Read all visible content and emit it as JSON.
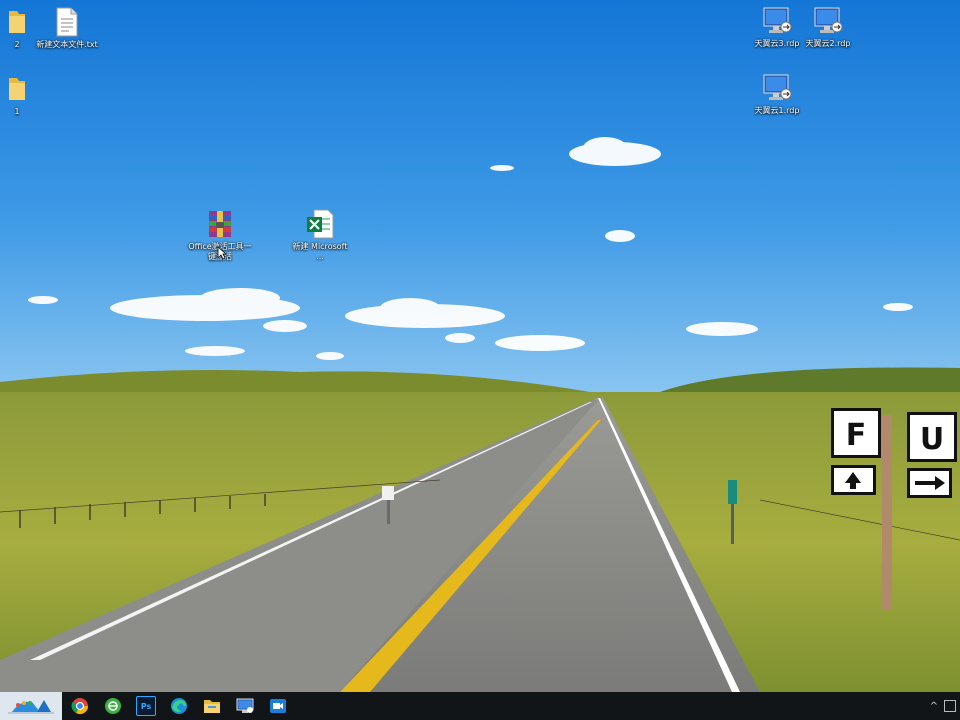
{
  "desktop": {
    "icons": [
      {
        "label": "2",
        "icon": "folder-icon"
      },
      {
        "label": "新建文本文件.txt",
        "icon": "text-file-icon"
      },
      {
        "label": "1",
        "icon": "folder-icon"
      },
      {
        "label": "天翼云3.rdp",
        "icon": "remote-desktop-icon"
      },
      {
        "label": "天翼云2.rdp",
        "icon": "remote-desktop-icon"
      },
      {
        "label": "天翼云1.rdp",
        "icon": "remote-desktop-icon"
      },
      {
        "label": "Office激活工具一键激活",
        "icon": "winrar-archive-icon"
      },
      {
        "label": "新建 Microsoft ...",
        "icon": "excel-file-icon"
      }
    ],
    "road_signs": {
      "left": "F",
      "right": "U"
    }
  },
  "taskbar": {
    "buttons": [
      {
        "name": "start-button",
        "icon": "start-logo-icon"
      },
      {
        "name": "chrome-button",
        "icon": "chrome-icon"
      },
      {
        "name": "green-app-button",
        "icon": "green-circle-app-icon"
      },
      {
        "name": "photoshop-button",
        "icon": "photoshop-icon",
        "text": "Ps"
      },
      {
        "name": "edge-button",
        "icon": "edge-icon"
      },
      {
        "name": "file-explorer-button",
        "icon": "folder-icon"
      },
      {
        "name": "remote-desktop-button",
        "icon": "remote-desktop-icon"
      },
      {
        "name": "screen-recorder-button",
        "icon": "video-camera-icon"
      }
    ],
    "tray": {
      "chevron": "^"
    }
  }
}
